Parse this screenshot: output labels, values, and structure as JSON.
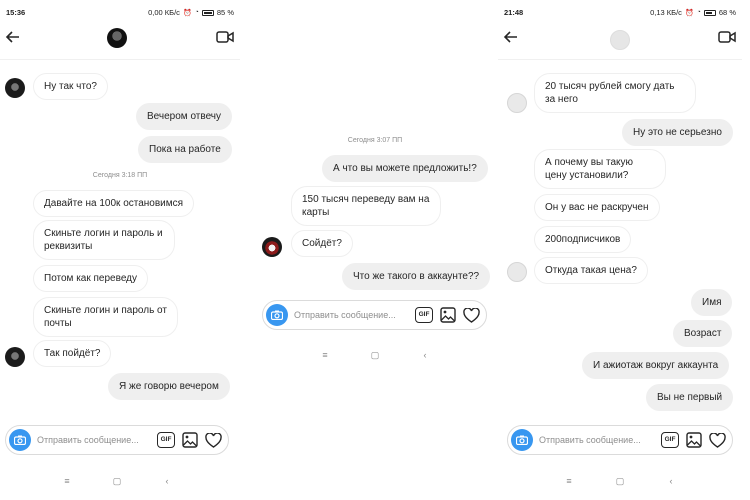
{
  "screen1": {
    "status": {
      "time": "15:36",
      "speed": "0,00 КБ/с",
      "battery": "85 %"
    },
    "messages": [
      {
        "text": "Ну так что?",
        "side": "them"
      },
      {
        "text": "Вечером отвечу",
        "side": "me"
      },
      {
        "text": "Пока на работе",
        "side": "me"
      },
      {
        "text": "Давайте на 100к остановимся",
        "side": "them"
      },
      {
        "text": "Скиньте логин и пароль и реквизиты",
        "side": "them"
      },
      {
        "text": "Потом как переведу",
        "side": "them"
      },
      {
        "text": "Скиньте логин и пароль от почты",
        "side": "them"
      },
      {
        "text": "Так пойдёт?",
        "side": "them"
      },
      {
        "text": "Я же говорю вечером",
        "side": "me"
      }
    ],
    "timestamp": "Сегодня 3:18 ПП",
    "composer_placeholder": "Отправить сообщение..."
  },
  "screen2": {
    "timestamp": "Сегодня 3:07 ПП",
    "messages": [
      {
        "text": "А что  вы можете предложить!?",
        "side": "me"
      },
      {
        "text": "150 тысяч переведу вам на карты",
        "side": "them"
      },
      {
        "text": "Сойдёт?",
        "side": "them"
      },
      {
        "text": "Что же такого в аккаунте??",
        "side": "me"
      }
    ],
    "composer_placeholder": "Отправить сообщение..."
  },
  "screen3": {
    "status": {
      "time": "21:48",
      "speed": "0,13 КБ/с",
      "battery": "68 %"
    },
    "messages": [
      {
        "text": "20 тысяч рублей смогу дать за него",
        "side": "them"
      },
      {
        "text": "Ну это не серьезно",
        "side": "me"
      },
      {
        "text": "А почему вы такую цену установили?",
        "side": "them"
      },
      {
        "text": "Он у вас не раскручен",
        "side": "them"
      },
      {
        "text": "200подписчиков",
        "side": "them"
      },
      {
        "text": "Откуда такая цена?",
        "side": "them"
      },
      {
        "text": "Имя",
        "side": "me"
      },
      {
        "text": "Возраст",
        "side": "me"
      },
      {
        "text": "И ажиотаж вокруг аккаунта",
        "side": "me"
      },
      {
        "text": "Вы не первый",
        "side": "me"
      }
    ],
    "composer_placeholder": "Отправить сообщение..."
  },
  "icons": {
    "composer_gif": "GIF",
    "theme": {
      "accent": "#3897f0",
      "bubble_me": "#efefef",
      "text": "#262626",
      "muted": "#8e8e8e"
    }
  }
}
